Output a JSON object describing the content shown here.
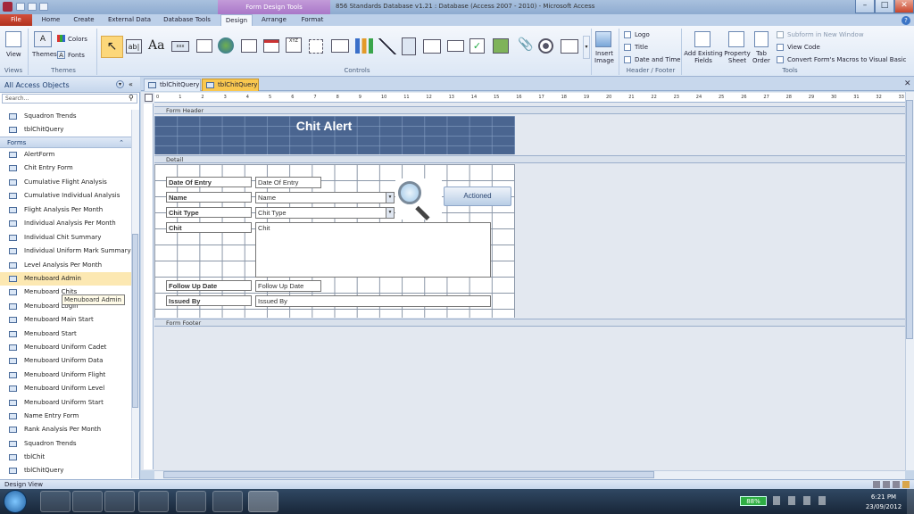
{
  "window": {
    "title": "856 Standards Database v1.21 : Database (Access 2007 - 2010) - Microsoft Access",
    "context_tab_label": "Form Design Tools"
  },
  "ribbon_tabs": [
    "File",
    "Home",
    "Create",
    "External Data",
    "Database Tools",
    "Design",
    "Arrange",
    "Format"
  ],
  "active_tab": "Design",
  "ribbon": {
    "views": {
      "view_label": "View",
      "group": "Views"
    },
    "themes": {
      "themes_label": "Themes",
      "colors_label": "Colors",
      "fonts_label": "Fonts",
      "group": "Themes"
    },
    "controls": {
      "group": "Controls"
    },
    "insert_image_label": "Insert Image",
    "header_footer": {
      "logo": "Logo",
      "title": "Title",
      "date_time": "Date and Time",
      "group": "Header / Footer"
    },
    "tools": {
      "add_existing_fields": "Add Existing Fields",
      "property_sheet": "Property Sheet",
      "tab_order": "Tab Order",
      "subform": "Subform in New Window",
      "view_code": "View Code",
      "convert_macros": "Convert Form's Macros to Visual Basic",
      "group": "Tools"
    }
  },
  "nav_pane": {
    "title": "All Access Objects",
    "search_placeholder": "Search...",
    "top_items": [
      "Squadron Trends",
      "tblChitQuery"
    ],
    "forms_header": "Forms",
    "forms": [
      "AlertForm",
      "Chit Entry Form",
      "Cumulative Flight Analysis",
      "Cumulative Individual Analysis",
      "Flight Analysis Per Month",
      "Individual Analysis Per Month",
      "Individual Chit Summary",
      "Individual Uniform Mark Summary",
      "Level Analysis Per Month",
      "Menuboard Admin",
      "Menuboard Chits",
      "Menuboard Login",
      "Menuboard Main Start",
      "Menuboard Start",
      "Menuboard Uniform Cadet",
      "Menuboard Uniform Data",
      "Menuboard Uniform Flight",
      "Menuboard Uniform Level",
      "Menuboard Uniform Start",
      "Name Entry Form",
      "Rank Analysis Per Month",
      "Squadron Trends",
      "tblChit",
      "tblChitQuery"
    ],
    "highlighted": "Menuboard Admin",
    "tooltip": "Menuboard Admin"
  },
  "doc_tabs": [
    "tblChitQuery",
    "tblChitQuery"
  ],
  "form": {
    "header_section": "Form Header",
    "title": "Chit Alert",
    "detail_section": "Detail",
    "footer_section": "Form Footer",
    "fields": [
      {
        "label": "Date Of Entry",
        "value": "Date Of Entry"
      },
      {
        "label": "Name",
        "value": "Name"
      },
      {
        "label": "Chit Type",
        "value": "Chit Type"
      },
      {
        "label": "Chit",
        "value": "Chit"
      },
      {
        "label": "Follow Up Date",
        "value": "Follow Up Date"
      },
      {
        "label": "Issued By",
        "value": "Issued By"
      }
    ],
    "actioned_button": "Actioned"
  },
  "status": {
    "left": "Design View"
  },
  "taskbar": {
    "battery": "88%",
    "time": "6:21 PM",
    "date": "23/09/2012"
  },
  "colors": {
    "header_band": "#4a6590",
    "highlight": "#fce8b2",
    "active_doc_tab": "#f9c74f",
    "file_tab": "#c9462c"
  }
}
